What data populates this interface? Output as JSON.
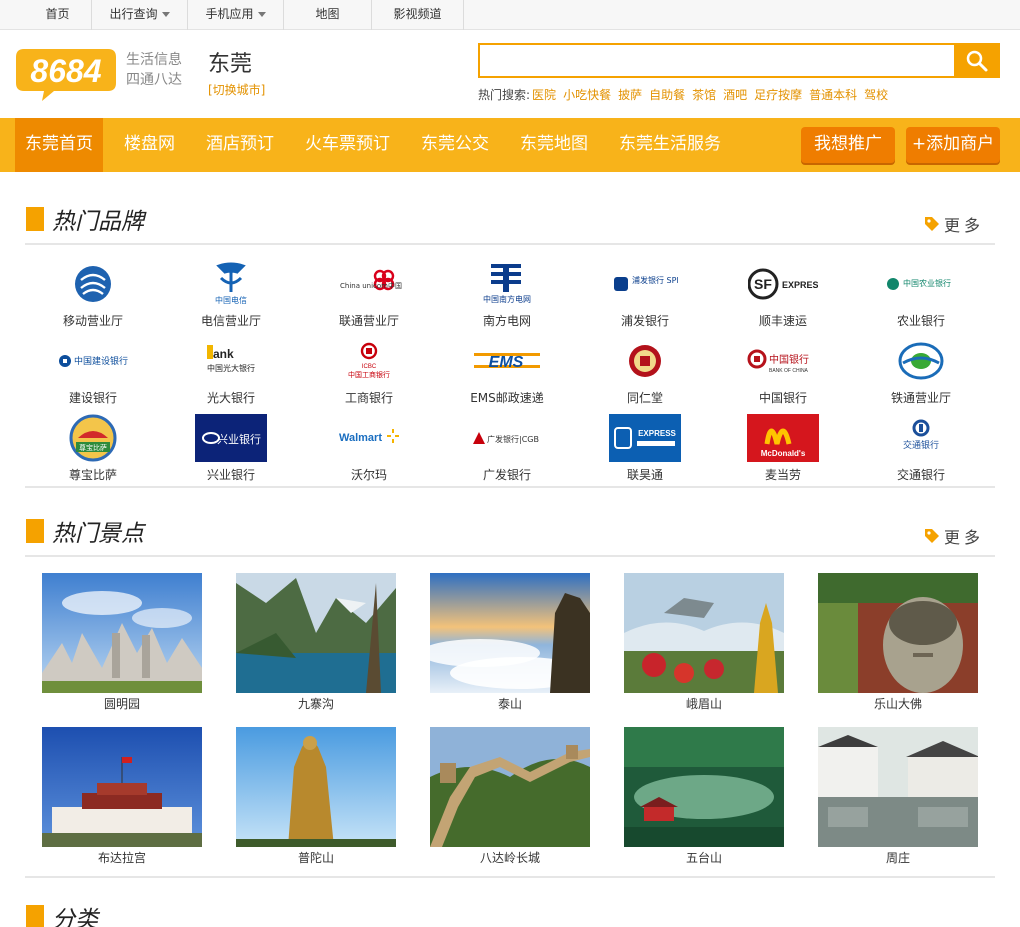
{
  "topnav": [
    {
      "label": "首页",
      "dropdown": false
    },
    {
      "label": "出行查询",
      "dropdown": true
    },
    {
      "label": "手机应用",
      "dropdown": true
    },
    {
      "label": "地图",
      "dropdown": false
    },
    {
      "label": "影视频道",
      "dropdown": false
    }
  ],
  "header": {
    "logo_text": "8684",
    "slogan_line1": "生活信息",
    "slogan_line2": "四通八达",
    "city": "东莞",
    "switch_city": "[切换城市]",
    "search_placeholder": "",
    "hot_label": "热门搜索:",
    "hot_terms": [
      "医院",
      "小吃快餐",
      "披萨",
      "自助餐",
      "茶馆",
      "酒吧",
      "足疗按摩",
      "普通本科",
      "驾校"
    ]
  },
  "mainnav": {
    "items": [
      "东莞首页",
      "楼盘网",
      "酒店预订",
      "火车票预订",
      "东莞公交",
      "东莞地图",
      "东莞生活服务"
    ],
    "promote_label": "我想推广",
    "add_merchant_label": "+添加商户"
  },
  "brands_section": {
    "title": "热门品牌",
    "more": "更多",
    "brands": [
      {
        "name": "移动营业厅",
        "logo": "china-mobile-logo",
        "logo_text": ""
      },
      {
        "name": "电信营业厅",
        "logo": "china-telecom-logo",
        "logo_text": "中国电信"
      },
      {
        "name": "联通营业厅",
        "logo": "china-unicom-logo",
        "logo_text": "China unicom中国联通"
      },
      {
        "name": "南方电网",
        "logo": "china-southern-grid-logo",
        "logo_text": "中国南方电网"
      },
      {
        "name": "浦发银行",
        "logo": "spd-bank-logo",
        "logo_text": "浦发银行 SPD BANK"
      },
      {
        "name": "顺丰速运",
        "logo": "sf-express-logo",
        "logo_text": "EXPRESS"
      },
      {
        "name": "农业银行",
        "logo": "abc-bank-logo",
        "logo_text": "中国农业银行"
      },
      {
        "name": "建设银行",
        "logo": "ccb-bank-logo",
        "logo_text": "中国建设银行"
      },
      {
        "name": "光大银行",
        "logo": "ceb-bank-logo",
        "logo_text": "中国光大银行"
      },
      {
        "name": "工商银行",
        "logo": "icbc-bank-logo",
        "logo_text": "中国工商银行"
      },
      {
        "name": "EMS邮政速递",
        "logo": "ems-logo",
        "logo_text": "EMS"
      },
      {
        "name": "同仁堂",
        "logo": "tongrentang-logo",
        "logo_text": ""
      },
      {
        "name": "中国银行",
        "logo": "bank-of-china-logo",
        "logo_text": "中国银行"
      },
      {
        "name": "铁通营业厅",
        "logo": "china-tietong-logo",
        "logo_text": ""
      },
      {
        "name": "尊宝比萨",
        "logo": "zunbao-pizza-logo",
        "logo_text": "尊宝比萨"
      },
      {
        "name": "兴业银行",
        "logo": "cib-bank-logo",
        "logo_text": "兴业银行"
      },
      {
        "name": "沃尔玛",
        "logo": "walmart-logo",
        "logo_text": "Walmart"
      },
      {
        "name": "广发银行",
        "logo": "cgb-bank-logo",
        "logo_text": "广发银行|CGB"
      },
      {
        "name": "联昊通",
        "logo": "lianhaotong-logo",
        "logo_text": "EXPRESS"
      },
      {
        "name": "麦当劳",
        "logo": "mcdonalds-logo",
        "logo_text": "McDonald's"
      },
      {
        "name": "交通银行",
        "logo": "bocom-bank-logo",
        "logo_text": "交通银行"
      }
    ]
  },
  "spots_section": {
    "title": "热门景点",
    "more": "更多",
    "spots": [
      {
        "name": "圆明园",
        "photo": "ruins-photo"
      },
      {
        "name": "九寨沟",
        "photo": "mountain-lake-photo"
      },
      {
        "name": "泰山",
        "photo": "sea-of-clouds-photo"
      },
      {
        "name": "峨眉山",
        "photo": "golden-buddha-photo"
      },
      {
        "name": "乐山大佛",
        "photo": "giant-buddha-photo"
      },
      {
        "name": "布达拉宫",
        "photo": "potala-palace-photo"
      },
      {
        "name": "普陀山",
        "photo": "guanyin-statue-photo"
      },
      {
        "name": "八达岭长城",
        "photo": "great-wall-photo"
      },
      {
        "name": "五台山",
        "photo": "forest-temple-photo"
      },
      {
        "name": "周庄",
        "photo": "water-town-photo"
      }
    ]
  },
  "category_section": {
    "title": "分类"
  },
  "colors": {
    "accent": "#f8b31a",
    "accent_dark": "#ee8a00",
    "link": "#e39200"
  }
}
